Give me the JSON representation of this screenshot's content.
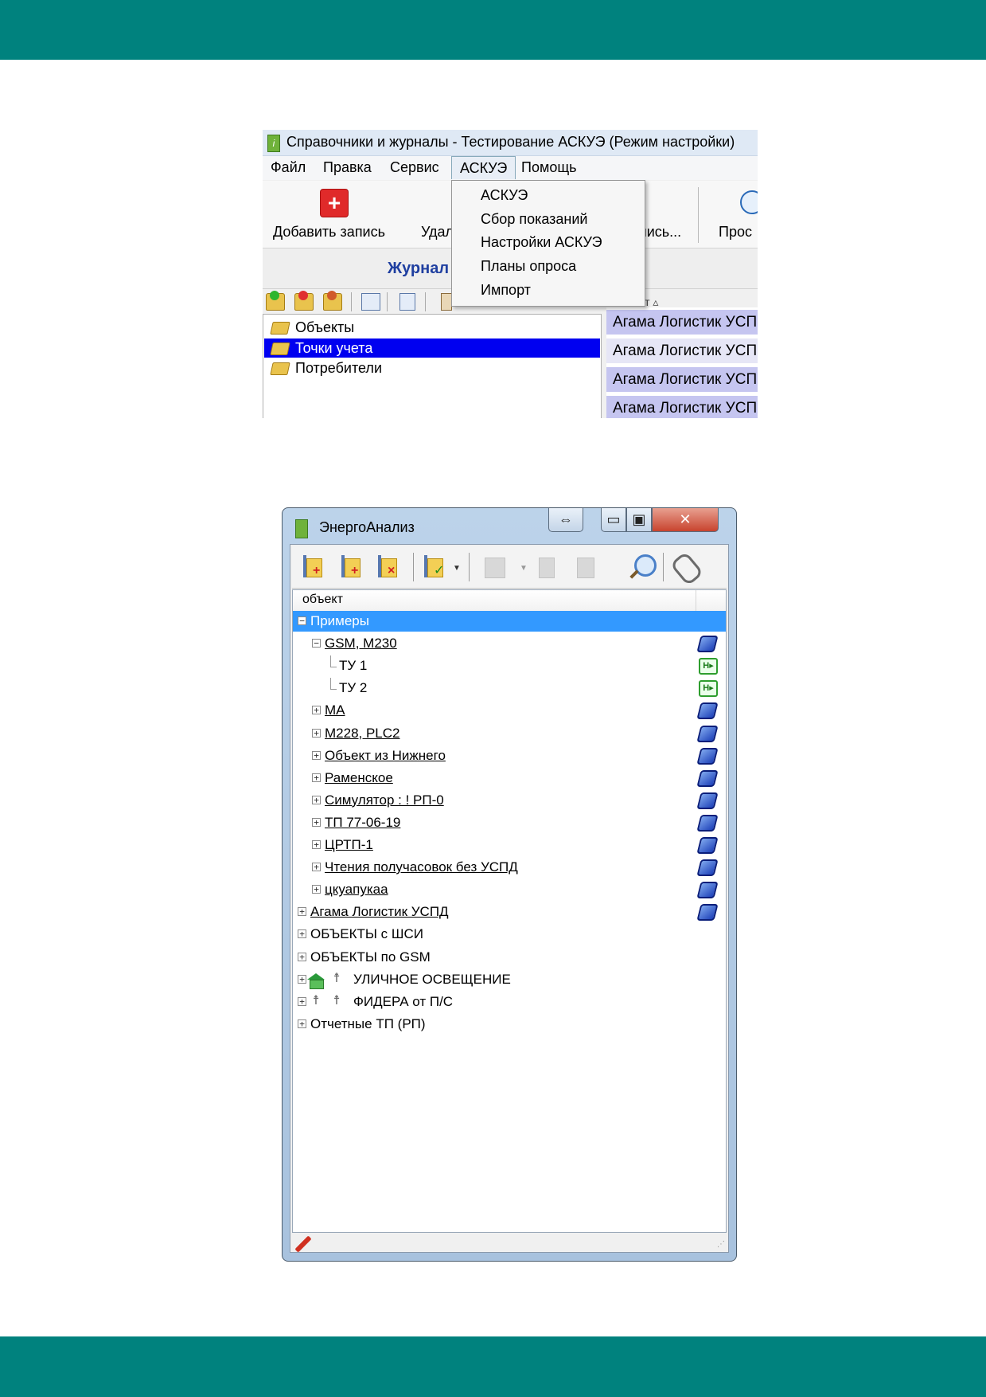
{
  "colors": {
    "band": "#00827e",
    "selection_blue": "#0000f0",
    "tree_selection": "#3399ff",
    "header_text": "#1f3fa0"
  },
  "screenshot1": {
    "title": "Справочники и журналы - Тестирование АСКУЭ (Режим настройки)",
    "menu": [
      "Файл",
      "Правка",
      "Сервис",
      "АСКУЭ",
      "Помощь"
    ],
    "active_menu": "АСКУЭ",
    "toolbar": {
      "add_label": "Добавить запись",
      "delete_label_partial": "Удал",
      "edit_label_partial": "пись...",
      "view_label_partial": "Прос"
    },
    "header_partial": "Журнал",
    "dropdown_items": [
      "АСКУЭ",
      "Сбор показаний",
      "Настройки АСКУЭ",
      "Планы опроса",
      "Импорт"
    ],
    "grid_column_partial": "ект",
    "tree": [
      {
        "label": "Объекты",
        "selected": false
      },
      {
        "label": "Точки учета",
        "selected": true
      },
      {
        "label": "Потребители",
        "selected": false
      }
    ],
    "grid_rows": [
      "Агама Логистик УСП",
      "Агама Логистик УСП",
      "Агама Логистик УСП",
      "Агама Логистик УСП"
    ]
  },
  "screenshot2": {
    "title": "ЭнергоАнализ",
    "column_header": "объект",
    "rows": [
      {
        "label": "Примеры",
        "level": 0,
        "expander": "-",
        "selected": true,
        "underline": false,
        "icon": ""
      },
      {
        "label": "GSM, M230",
        "level": 1,
        "expander": "-",
        "underline": true,
        "icon": "blue"
      },
      {
        "label": "ТУ 1",
        "level": 2,
        "expander": "",
        "underline": false,
        "icon": "green"
      },
      {
        "label": "ТУ 2",
        "level": 2,
        "expander": "",
        "underline": false,
        "icon": "green"
      },
      {
        "label": "МА",
        "level": 1,
        "expander": "+",
        "underline": true,
        "icon": "blue"
      },
      {
        "label": "M228, PLC2",
        "level": 1,
        "expander": "+",
        "underline": true,
        "icon": "blue"
      },
      {
        "label": "Объект из Нижнего",
        "level": 1,
        "expander": "+",
        "underline": true,
        "icon": "blue"
      },
      {
        "label": "Раменское",
        "level": 1,
        "expander": "+",
        "underline": true,
        "icon": "blue"
      },
      {
        "label": "Симулятор : ! РП-0",
        "level": 1,
        "expander": "+",
        "underline": true,
        "icon": "blue"
      },
      {
        "label": "ТП 77-06-19",
        "level": 1,
        "expander": "+",
        "underline": true,
        "icon": "blue"
      },
      {
        "label": "ЦРТП-1",
        "level": 1,
        "expander": "+",
        "underline": true,
        "icon": "blue"
      },
      {
        "label": "Чтения получасовок без УСПД",
        "level": 1,
        "expander": "+",
        "underline": true,
        "icon": "blue"
      },
      {
        "label": "цкуапукаа",
        "level": 1,
        "expander": "+",
        "underline": true,
        "icon": "blue"
      },
      {
        "label": "Агама Логистик УСПД",
        "level": 0,
        "expander": "+",
        "underline": true,
        "icon": "blue"
      },
      {
        "label": "ОБЪЕКТЫ с ШСИ",
        "level": 0,
        "expander": "+",
        "underline": false,
        "icon": ""
      },
      {
        "label": "ОБЪЕКТЫ по GSM",
        "level": 0,
        "expander": "+",
        "underline": false,
        "icon": ""
      },
      {
        "label": "УЛИЧНОЕ ОСВЕЩЕНИЕ",
        "level": 0,
        "expander": "+",
        "underline": false,
        "icon": "",
        "prefix": "house-pole"
      },
      {
        "label": "ФИДЕРА от П/С",
        "level": 0,
        "expander": "+",
        "underline": false,
        "icon": "",
        "prefix": "poles"
      },
      {
        "label": "Отчетные ТП (РП)",
        "level": 0,
        "expander": "+",
        "underline": false,
        "icon": ""
      }
    ]
  }
}
